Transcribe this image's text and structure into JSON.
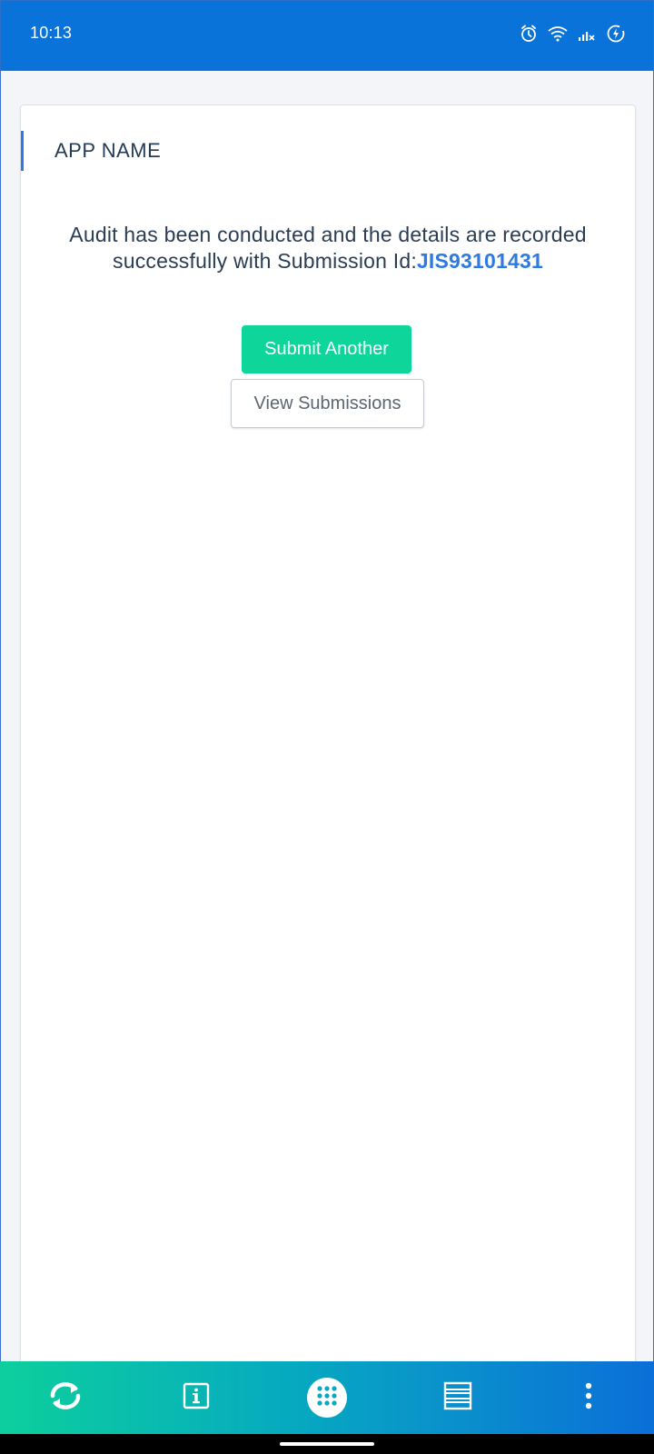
{
  "status_bar": {
    "time": "10:13",
    "icons": [
      "alarm-icon",
      "wifi-icon",
      "signal-icon",
      "battery-saver-icon"
    ]
  },
  "card": {
    "app_name": "APP NAME",
    "message_text": "Audit has been conducted and the details are recorded successfully with Submission Id:",
    "submission_id": "JIS93101431",
    "primary_button_label": "Submit Another",
    "secondary_button_label": "View Submissions"
  },
  "bottom_nav": {
    "items": [
      {
        "icon": "sync-icon"
      },
      {
        "icon": "info-icon"
      },
      {
        "icon": "apps-grid-icon"
      },
      {
        "icon": "list-icon"
      },
      {
        "icon": "more-vertical-icon"
      }
    ]
  },
  "colors": {
    "status_bar": "#0a73d9",
    "accent": "#2d7be0",
    "primary_button": "#0ed69a"
  }
}
